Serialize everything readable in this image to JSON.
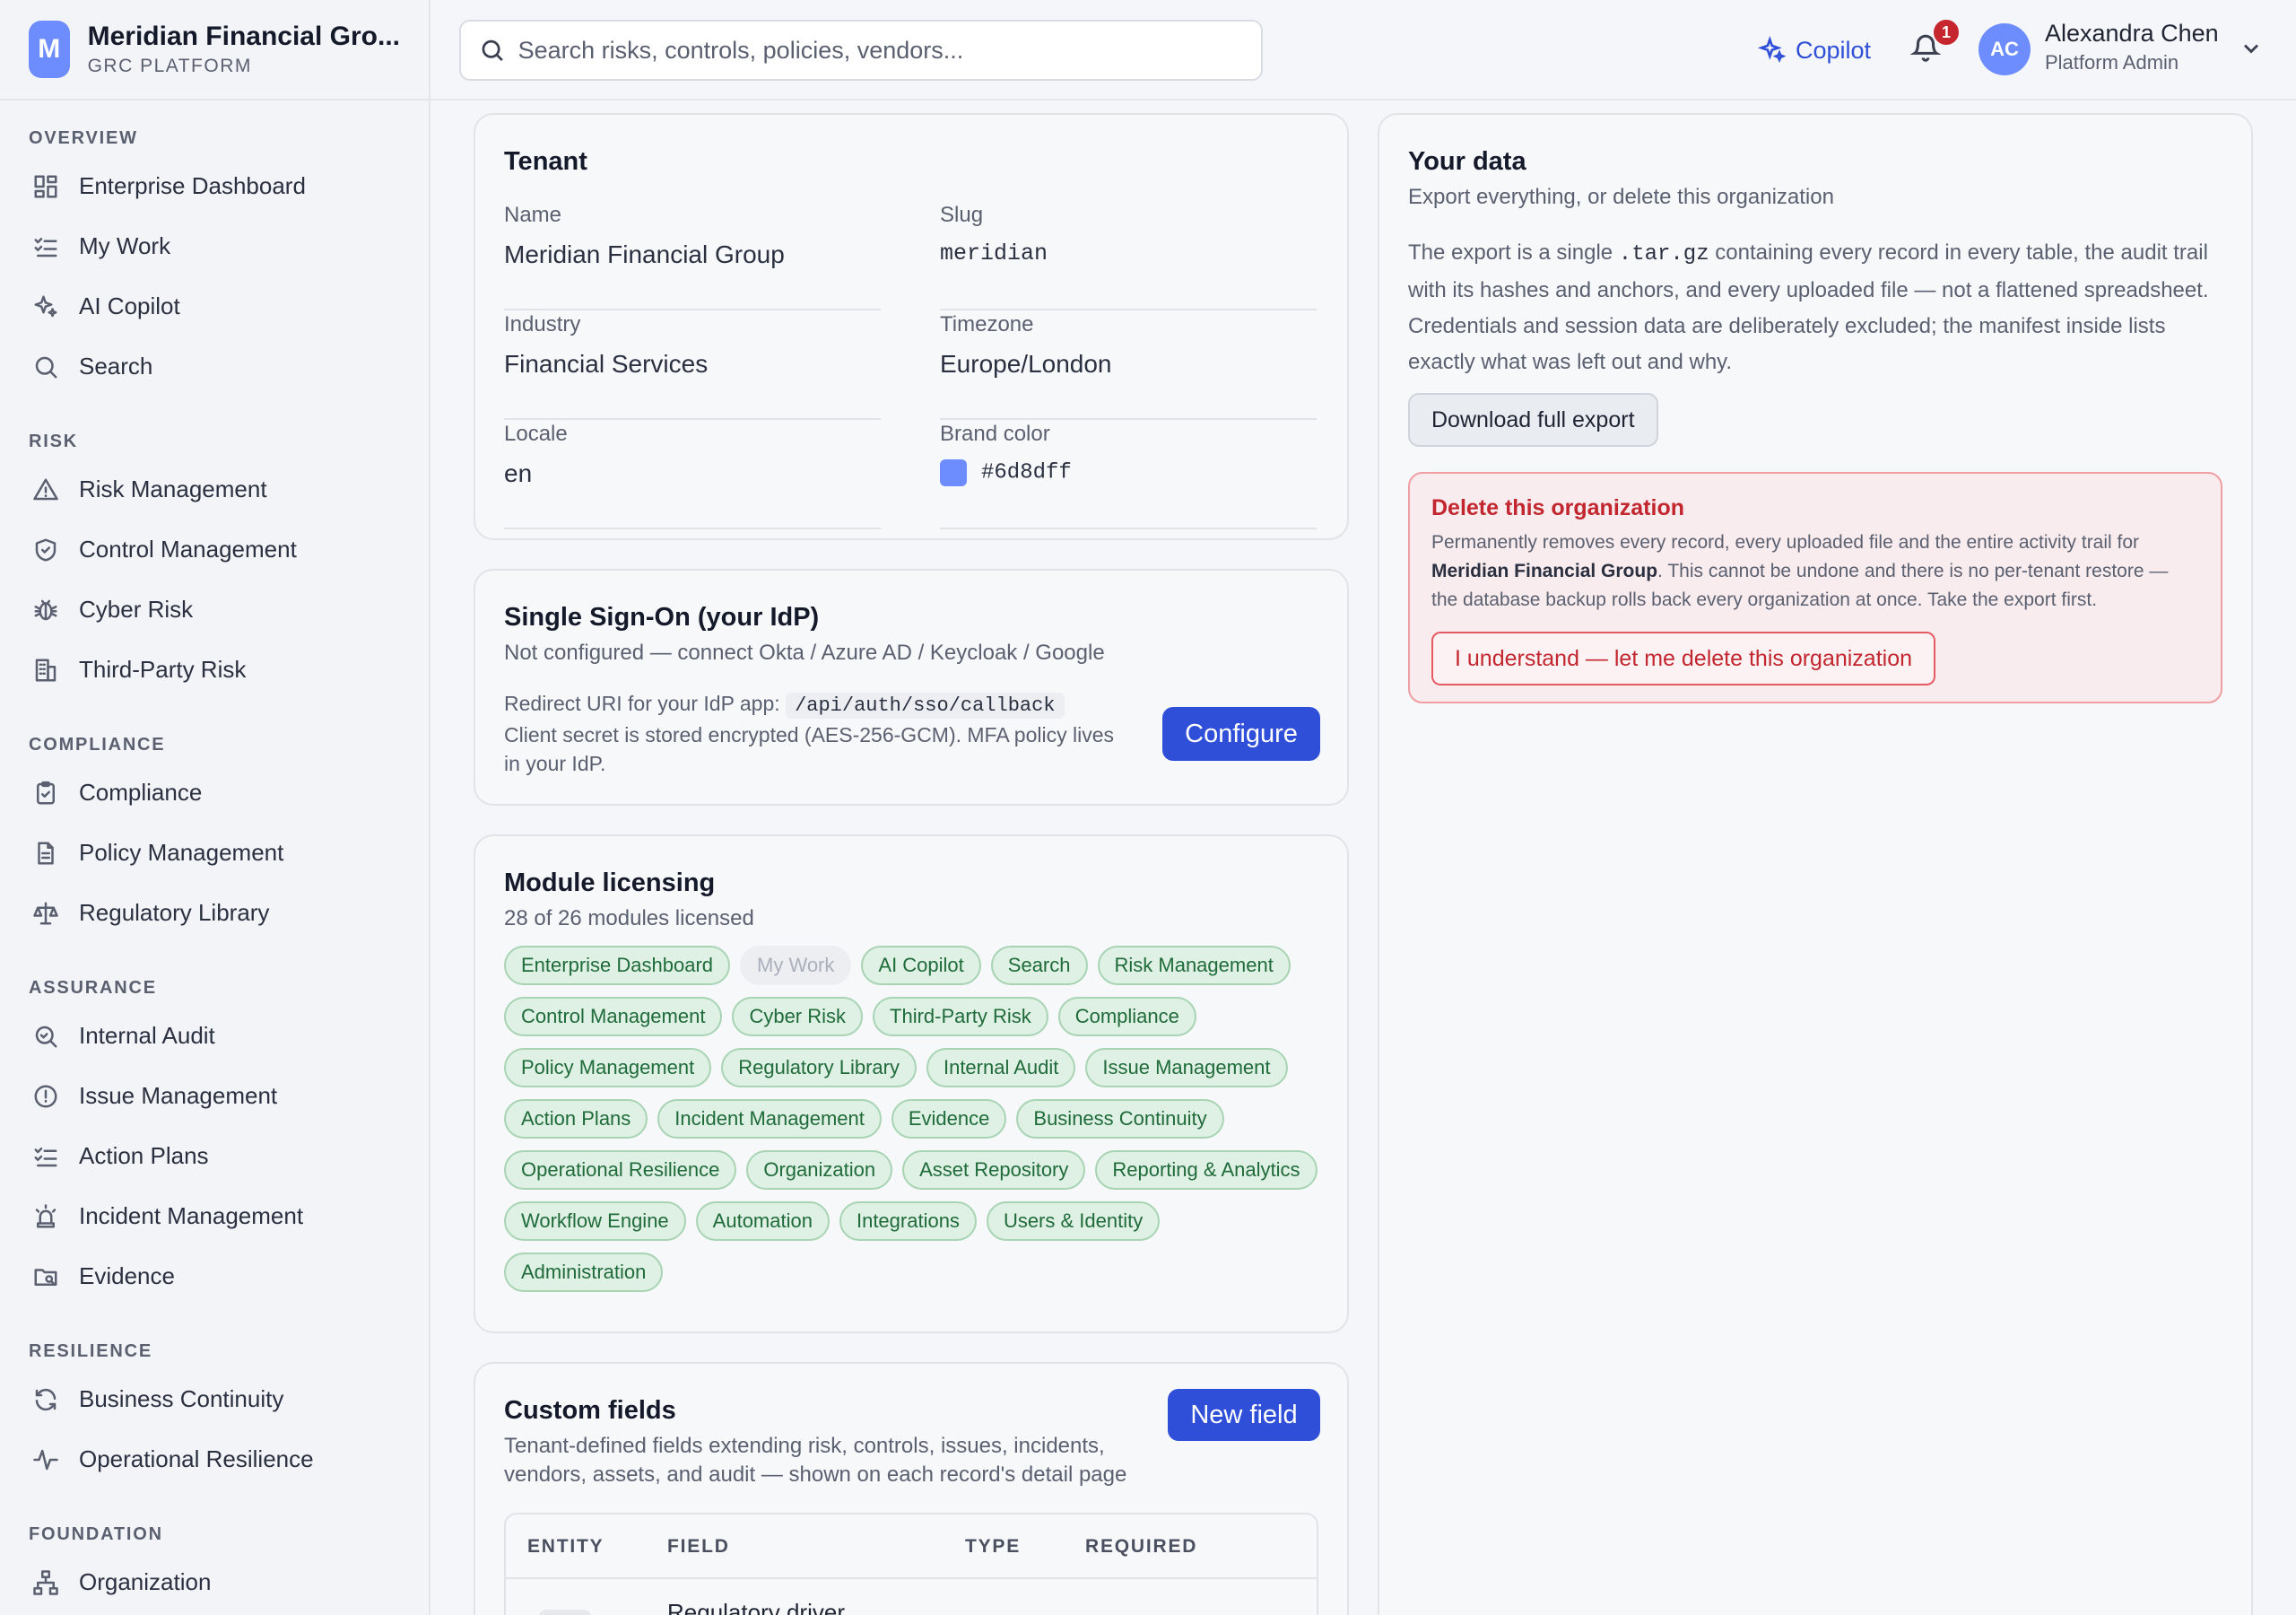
{
  "brand": {
    "logo_letter": "M",
    "name": "Meridian Financial Gro...",
    "subtitle": "GRC PLATFORM",
    "color": "#6d8dff"
  },
  "sidebar": {
    "groups": [
      {
        "title": "OVERVIEW",
        "items": [
          {
            "label": "Enterprise Dashboard",
            "icon": "dashboard-icon"
          },
          {
            "label": "My Work",
            "icon": "checklist-icon"
          },
          {
            "label": "AI Copilot",
            "icon": "sparkles-icon"
          },
          {
            "label": "Search",
            "icon": "search-icon"
          }
        ]
      },
      {
        "title": "RISK",
        "items": [
          {
            "label": "Risk Management",
            "icon": "warning-triangle-icon"
          },
          {
            "label": "Control Management",
            "icon": "shield-check-icon"
          },
          {
            "label": "Cyber Risk",
            "icon": "bug-icon"
          },
          {
            "label": "Third-Party Risk",
            "icon": "building-icon"
          }
        ]
      },
      {
        "title": "COMPLIANCE",
        "items": [
          {
            "label": "Compliance",
            "icon": "clipboard-check-icon"
          },
          {
            "label": "Policy Management",
            "icon": "document-icon"
          },
          {
            "label": "Regulatory Library",
            "icon": "scale-icon"
          }
        ]
      },
      {
        "title": "ASSURANCE",
        "items": [
          {
            "label": "Internal Audit",
            "icon": "search-check-icon"
          },
          {
            "label": "Issue Management",
            "icon": "alert-circle-icon"
          },
          {
            "label": "Action Plans",
            "icon": "list-checks-icon"
          },
          {
            "label": "Incident Management",
            "icon": "siren-icon"
          },
          {
            "label": "Evidence",
            "icon": "folder-search-icon"
          }
        ]
      },
      {
        "title": "RESILIENCE",
        "items": [
          {
            "label": "Business Continuity",
            "icon": "refresh-icon"
          },
          {
            "label": "Operational Resilience",
            "icon": "activity-icon"
          }
        ]
      },
      {
        "title": "FOUNDATION",
        "items": [
          {
            "label": "Organization",
            "icon": "org-chart-icon"
          }
        ]
      }
    ]
  },
  "topbar": {
    "search_placeholder": "Search risks, controls, policies, vendors...",
    "copilot_label": "Copilot",
    "notification_count": "1",
    "user": {
      "initials": "AC",
      "name": "Alexandra Chen",
      "role": "Platform Admin"
    }
  },
  "tenant": {
    "title": "Tenant",
    "fields": {
      "name": {
        "label": "Name",
        "value": "Meridian Financial Group"
      },
      "slug": {
        "label": "Slug",
        "value": "meridian"
      },
      "industry": {
        "label": "Industry",
        "value": "Financial Services"
      },
      "timezone": {
        "label": "Timezone",
        "value": "Europe/London"
      },
      "locale": {
        "label": "Locale",
        "value": "en"
      },
      "brand_color": {
        "label": "Brand color",
        "value": "#6d8dff"
      }
    }
  },
  "sso": {
    "title": "Single Sign-On (your IdP)",
    "subtitle": "Not configured — connect Okta / Azure AD / Keycloak / Google",
    "redirect_label": "Redirect URI for your IdP app:",
    "redirect_uri": "/api/auth/sso/callback",
    "note": "Client secret is stored encrypted (AES-256-GCM). MFA policy lives in your IdP.",
    "configure_label": "Configure"
  },
  "modules": {
    "title": "Module licensing",
    "subtitle": "28 of 26 modules licensed",
    "chips": [
      {
        "label": "Enterprise Dashboard",
        "on": true
      },
      {
        "label": "My Work",
        "on": false
      },
      {
        "label": "AI Copilot",
        "on": true
      },
      {
        "label": "Search",
        "on": true
      },
      {
        "label": "Risk Management",
        "on": true
      },
      {
        "label": "Control Management",
        "on": true
      },
      {
        "label": "Cyber Risk",
        "on": true
      },
      {
        "label": "Third-Party Risk",
        "on": true
      },
      {
        "label": "Compliance",
        "on": true
      },
      {
        "label": "Policy Management",
        "on": true
      },
      {
        "label": "Regulatory Library",
        "on": true
      },
      {
        "label": "Internal Audit",
        "on": true
      },
      {
        "label": "Issue Management",
        "on": true
      },
      {
        "label": "Action Plans",
        "on": true
      },
      {
        "label": "Incident Management",
        "on": true
      },
      {
        "label": "Evidence",
        "on": true
      },
      {
        "label": "Business Continuity",
        "on": true
      },
      {
        "label": "Operational Resilience",
        "on": true
      },
      {
        "label": "Organization",
        "on": true
      },
      {
        "label": "Asset Repository",
        "on": true
      },
      {
        "label": "Reporting & Analytics",
        "on": true
      },
      {
        "label": "Workflow Engine",
        "on": true
      },
      {
        "label": "Automation",
        "on": true
      },
      {
        "label": "Integrations",
        "on": true
      },
      {
        "label": "Users & Identity",
        "on": true
      },
      {
        "label": "Administration",
        "on": true
      }
    ]
  },
  "custom_fields": {
    "title": "Custom fields",
    "subtitle": "Tenant-defined fields extending risk, controls, issues, incidents, vendors, assets, and audit — shown on each record's detail page",
    "new_label": "New field",
    "columns": [
      "ENTITY",
      "FIELD",
      "TYPE",
      "REQUIRED"
    ],
    "first_row_field": "Regulatory driver"
  },
  "your_data": {
    "title": "Your data",
    "subtitle": "Export everything, or delete this organization",
    "export_text_before": "The export is a single ",
    "export_code": ".tar.gz",
    "export_text_after": " containing every record in every table, the audit trail with its hashes and anchors, and every uploaded file — not a flattened spreadsheet. Credentials and session data are deliberately excluded; the manifest inside lists exactly what was left out and why.",
    "download_label": "Download full export",
    "delete": {
      "title": "Delete this organization",
      "text_before": "Permanently removes every record, every uploaded file and the entire activity trail for ",
      "org_name": "Meridian Financial Group",
      "text_after": ". This cannot be undone and there is no per-tenant restore — the database backup rolls back every organization at once. Take the export first.",
      "button_label": "I understand — let me delete this organization"
    }
  }
}
